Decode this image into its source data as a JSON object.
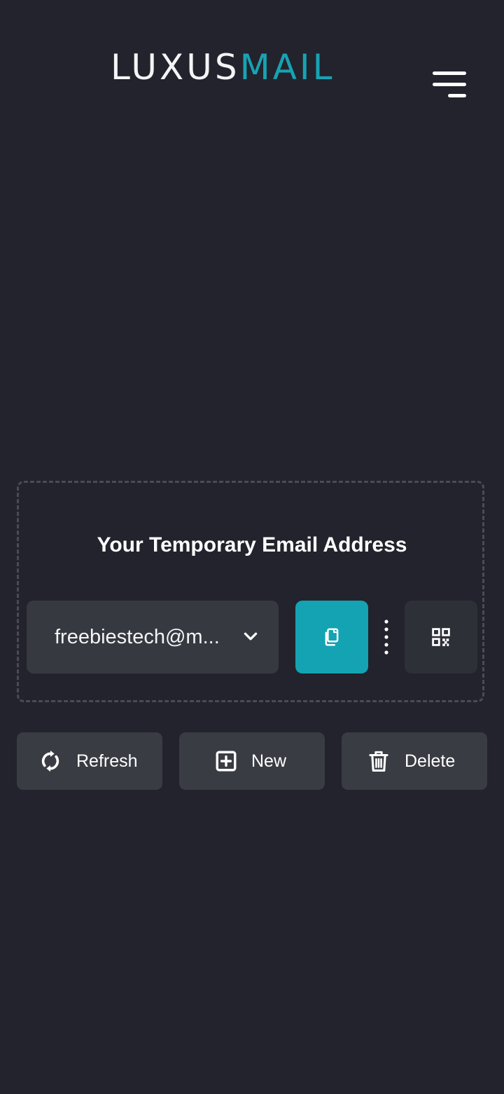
{
  "header": {
    "logo": {
      "part1": "LUXUS",
      "part2": "MAIL"
    }
  },
  "email_box": {
    "title": "Your Temporary Email Address",
    "email_value": "freebiestech@m..."
  },
  "actions": {
    "refresh_label": "Refresh",
    "new_label": "New",
    "delete_label": "Delete"
  },
  "colors": {
    "background": "#22232c",
    "accent": "#14a3b2",
    "surface": "#3a3c44"
  },
  "icons": {
    "menu": "hamburger-icon",
    "dropdown": "chevron-down-icon",
    "copy": "copy-icon",
    "more": "vertical-dots-icon",
    "qr": "qr-code-icon",
    "refresh": "refresh-icon",
    "new": "plus-square-icon",
    "delete": "trash-icon"
  }
}
